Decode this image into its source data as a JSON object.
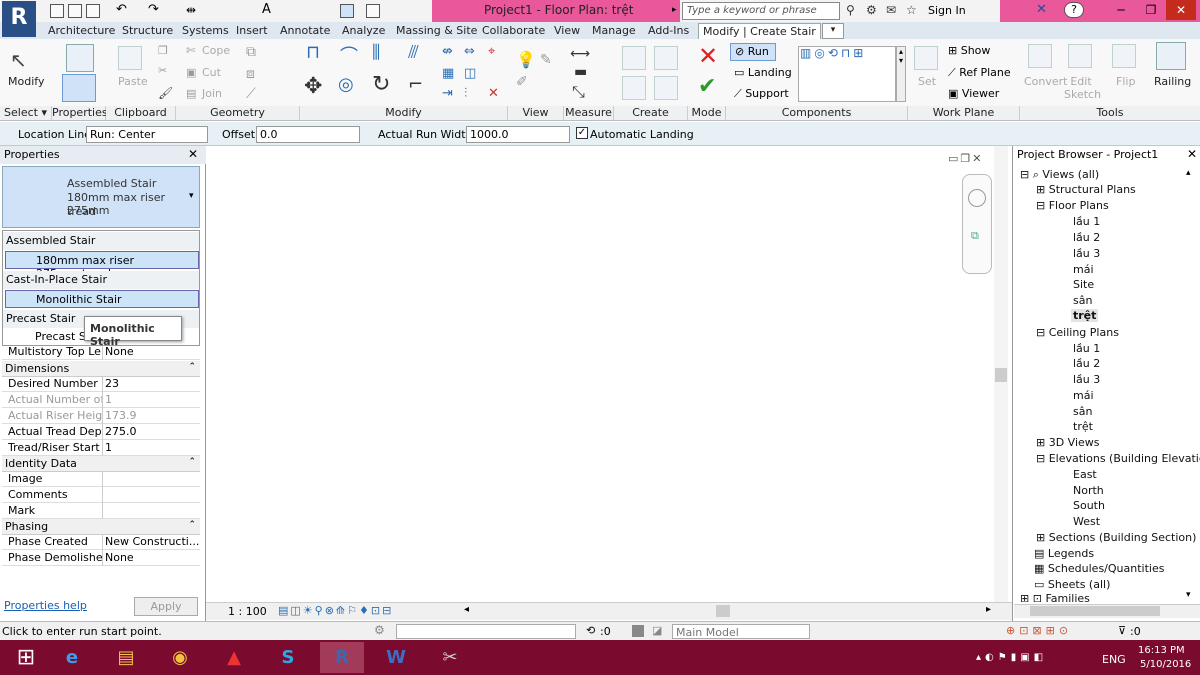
{
  "window": {
    "title": "Project1 - Floor Plan: trệt",
    "search_placeholder": "Type a keyword or phrase",
    "sign_in": "Sign In",
    "help": "?"
  },
  "tabs": [
    "Architecture",
    "Structure",
    "Systems",
    "Insert",
    "Annotate",
    "Analyze",
    "Massing & Site",
    "Collaborate",
    "View",
    "Manage",
    "Add-Ins",
    "Modify | Create Stair"
  ],
  "ribbon": {
    "modify": "Modify",
    "paste": "Paste",
    "cope": "Cope",
    "cut": "Cut",
    "join": "Join",
    "run": "Run",
    "landing": "Landing",
    "support": "Support",
    "show": "Show",
    "ref_plane": "Ref  Plane",
    "viewer": "Viewer",
    "set": "Set",
    "convert": "Convert",
    "edit_sketch": "Edit Sketch",
    "flip": "Flip",
    "railing": "Railing",
    "panels": [
      "Select ▾",
      "Properties",
      "Clipboard",
      "Geometry",
      "Modify",
      "View",
      "Measure",
      "Create",
      "Mode",
      "Components",
      "Work Plane",
      "Tools"
    ]
  },
  "options": {
    "location_line_label": "Location Line:",
    "location_line_value": "Run: Center",
    "offset_label": "Offset:",
    "offset_value": "0.0",
    "run_width_label": "Actual Run Width:",
    "run_width_value": "1000.0",
    "auto_landing": "Automatic Landing"
  },
  "properties": {
    "title": "Properties",
    "type_name_1": "Assembled Stair",
    "type_name_2": "180mm max riser 275mm",
    "type_name_3": "tread",
    "dropdown": {
      "g1": "Assembled Stair",
      "i1": "180mm max riser 275mm tread",
      "g2": "Cast-In-Place Stair",
      "i2": "Monolithic Stair",
      "g3": "Precast Stair",
      "i3": "Precast Sta"
    },
    "tooltip": "Monolithic Stair",
    "rows": {
      "multistory_k": "Multistory Top Le...",
      "multistory_v": "None",
      "dimensions": "Dimensions",
      "desired_k": "Desired Number ...",
      "desired_v": "23",
      "actual_num_k": "Actual Number of...",
      "actual_num_v": "1",
      "riser_k": "Actual Riser Height",
      "riser_v": "173.9",
      "tread_k": "Actual Tread Depth",
      "tread_v": "275.0",
      "trstart_k": "Tread/Riser Start ...",
      "trstart_v": "1",
      "identity": "Identity Data",
      "image": "Image",
      "comments": "Comments",
      "mark": "Mark",
      "phasing": "Phasing",
      "phase_created_k": "Phase Created",
      "phase_created_v": "New Constructi...",
      "phase_demolished_k": "Phase Demolished",
      "phase_demolished_v": "None"
    },
    "help": "Properties help",
    "apply": "Apply"
  },
  "viewbar": {
    "scale": "1 : 100"
  },
  "status": {
    "message": "Click to enter run start point.",
    "count": ":0",
    "model": "Main Model",
    "filter": ":0"
  },
  "browser": {
    "title": "Project Browser - Project1",
    "views_all": "Views (all)",
    "structural_plans": "Structural Plans",
    "floor_plans": "Floor Plans",
    "fp": [
      "lầu 1",
      "lầu 2",
      "lầu 3",
      "mái",
      "Site",
      "sân",
      "trệt"
    ],
    "ceiling_plans": "Ceiling Plans",
    "cp": [
      "lầu 1",
      "lầu 2",
      "lầu 3",
      "mái",
      "sân",
      "trệt"
    ],
    "views_3d": "3D Views",
    "elevations": "Elevations (Building Elevatic",
    "el": [
      "East",
      "North",
      "South",
      "West"
    ],
    "sections": "Sections (Building Section)",
    "legends": "Legends",
    "schedules": "Schedules/Quantities",
    "sheets": "Sheets (all)",
    "families": "Families"
  },
  "taskbar": {
    "lang": "ENG",
    "time": "16:13 PM",
    "date": "5/10/2016"
  },
  "colors": {
    "title_pink": "#e8589a",
    "taskbar": "#7b0a2f",
    "accent": "#2a4e86"
  }
}
